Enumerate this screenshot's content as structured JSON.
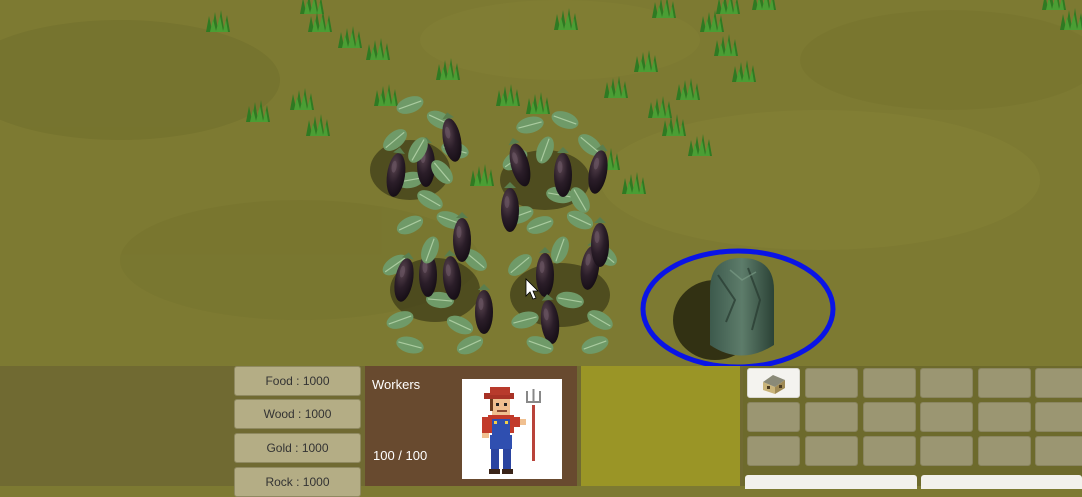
{
  "resources": {
    "food": "Food : 1000",
    "wood": "Wood : 1000",
    "gold": "Gold : 1000",
    "rock": "Rock : 1000"
  },
  "workers": {
    "title": "Workers",
    "count": "100 / 100",
    "portrait_icon": "farmer-with-pitchfork-icon"
  },
  "build_menu": {
    "slots": [
      {
        "icon": "house-icon",
        "active": true
      }
    ]
  },
  "scene": {
    "selection_color": "#0a14e6",
    "ground_color": "#7d7a32",
    "objects": [
      "eggplant-plant",
      "eggplant-plant",
      "eggplant-plant",
      "eggplant-plant",
      "resource-rock",
      "grass-tufts",
      "mouse-cursor"
    ]
  }
}
